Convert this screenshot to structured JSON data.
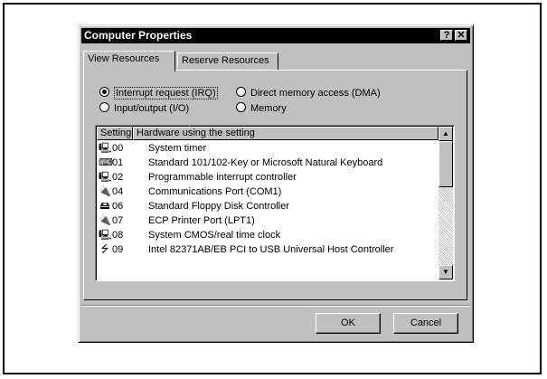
{
  "window": {
    "title": "Computer Properties",
    "help_glyph": "?",
    "close_glyph": "✕"
  },
  "tabs": [
    {
      "label": "View Resources",
      "active": true
    },
    {
      "label": "Reserve Resources",
      "active": false
    }
  ],
  "radios": [
    {
      "label": "Interrupt request (IRQ)",
      "checked": true
    },
    {
      "label": "Direct memory access (DMA)",
      "checked": false
    },
    {
      "label": "Input/output (I/O)",
      "checked": false
    },
    {
      "label": "Memory",
      "checked": false
    }
  ],
  "list": {
    "columns": {
      "setting": "Setting",
      "hardware": "Hardware using the setting"
    },
    "rows": [
      {
        "icon": "computer-icon",
        "setting": "00",
        "hardware": "System timer"
      },
      {
        "icon": "keyboard-icon",
        "setting": "01",
        "hardware": "Standard 101/102-Key or Microsoft Natural Keyboard"
      },
      {
        "icon": "computer-icon",
        "setting": "02",
        "hardware": "Programmable interrupt controller"
      },
      {
        "icon": "port-icon",
        "setting": "04",
        "hardware": "Communications Port (COM1)"
      },
      {
        "icon": "floppy-controller-icon",
        "setting": "06",
        "hardware": "Standard Floppy Disk Controller"
      },
      {
        "icon": "port-icon",
        "setting": "07",
        "hardware": "ECP Printer Port (LPT1)"
      },
      {
        "icon": "computer-icon",
        "setting": "08",
        "hardware": "System CMOS/real time clock"
      },
      {
        "icon": "usb-icon",
        "setting": "09",
        "hardware": "Intel 82371AB/EB PCI to USB Universal Host Controller"
      }
    ]
  },
  "buttons": {
    "ok": "OK",
    "cancel": "Cancel"
  }
}
